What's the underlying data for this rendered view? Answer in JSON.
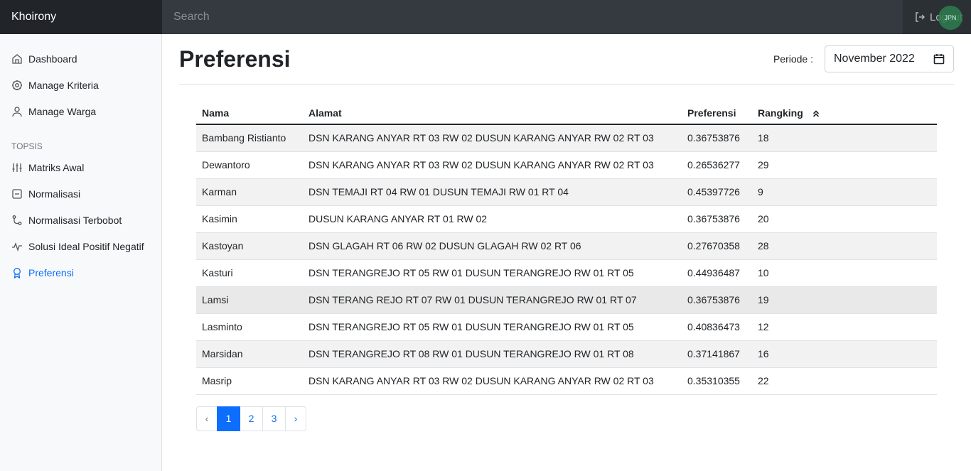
{
  "navbar": {
    "brand": "Khoirony",
    "search_placeholder": "Search",
    "logout_label": "Logout",
    "avatar_text": "JPN"
  },
  "sidebar": {
    "items": [
      {
        "label": "Dashboard",
        "icon": "home-icon"
      },
      {
        "label": "Manage Kriteria",
        "icon": "gear-icon"
      },
      {
        "label": "Manage Warga",
        "icon": "user-icon"
      }
    ],
    "section_heading": "TOPSIS",
    "topsis_items": [
      {
        "label": "Matriks Awal",
        "icon": "sliders-icon"
      },
      {
        "label": "Normalisasi",
        "icon": "square-minus-icon"
      },
      {
        "label": "Normalisasi Terbobot",
        "icon": "git-icon"
      },
      {
        "label": "Solusi Ideal Positif Negatif",
        "icon": "activity-icon"
      },
      {
        "label": "Preferensi",
        "icon": "award-icon",
        "active": true
      }
    ]
  },
  "main": {
    "title": "Preferensi",
    "periode_label": "Periode :",
    "periode_value": "November 2022"
  },
  "table": {
    "headers": [
      "Nama",
      "Alamat",
      "Preferensi",
      "Rangking"
    ],
    "rows": [
      [
        "Bambang Ristianto",
        "DSN KARANG ANYAR RT 03 RW 02 DUSUN KARANG ANYAR RW 02 RT 03",
        "0.36753876",
        "18"
      ],
      [
        "Dewantoro",
        "DSN KARANG ANYAR RT 03 RW 02 DUSUN KARANG ANYAR RW 02 RT 03",
        "0.26536277",
        "29"
      ],
      [
        "Karman",
        "DSN TEMAJI RT 04 RW 01 DUSUN TEMAJI RW 01 RT 04",
        "0.45397726",
        "9"
      ],
      [
        "Kasimin",
        "DUSUN KARANG ANYAR RT 01 RW 02",
        "0.36753876",
        "20"
      ],
      [
        "Kastoyan",
        "DSN GLAGAH RT 06 RW 02 DUSUN GLAGAH RW 02 RT 06",
        "0.27670358",
        "28"
      ],
      [
        "Kasturi",
        "DSN TERANGREJO RT 05 RW 01 DUSUN TERANGREJO RW 01 RT 05",
        "0.44936487",
        "10"
      ],
      [
        "Lamsi",
        "DSN TERANG REJO RT 07 RW 01 DUSUN TERANGREJO RW 01 RT 07",
        "0.36753876",
        "19"
      ],
      [
        "Lasminto",
        "DSN TERANGREJO RT 05 RW 01 DUSUN TERANGREJO RW 01 RT 05",
        "0.40836473",
        "12"
      ],
      [
        "Marsidan",
        "DSN TERANGREJO RT 08 RW 01 DUSUN TERANGREJO RW 01 RT 08",
        "0.37141867",
        "16"
      ],
      [
        "Masrip",
        "DSN KARANG ANYAR RT 03 RW 02 DUSUN KARANG ANYAR RW 02 RT 03",
        "0.35310355",
        "22"
      ]
    ]
  },
  "pagination": {
    "prev": "‹",
    "pages": [
      "1",
      "2",
      "3"
    ],
    "next": "›",
    "active": "1"
  },
  "colors": {
    "accent": "#0d6efd",
    "navbar": "#343a40",
    "sidebar_bg": "#f8f9fa"
  }
}
